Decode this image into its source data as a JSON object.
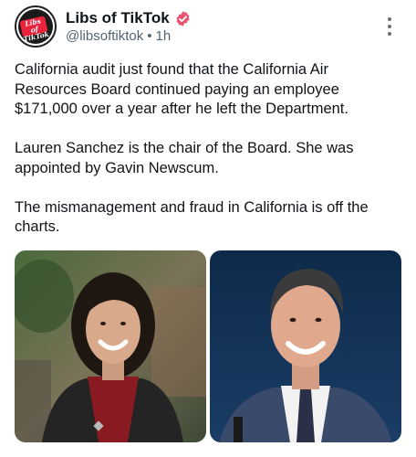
{
  "post": {
    "author": {
      "name": "Libs of TikTok",
      "handle": "@libsoftiktok",
      "separator": "•",
      "time": "1h",
      "avatar_text_line1": "Libs of",
      "avatar_text_line2": "TikTok",
      "verified": true
    },
    "menu_icon": "more-vertical-icon",
    "paragraphs": [
      "California audit just found that the California Air Resources Board continued paying an employee $171,000 over a year after he left the Department.",
      "Lauren Sanchez is the chair of the Board. She was appointed by Gavin Newscum.",
      "The mismanagement and fraud in California is off the charts."
    ],
    "media": [
      {
        "name": "photo-woman-portrait"
      },
      {
        "name": "photo-man-portrait"
      }
    ]
  },
  "colors": {
    "text": "#0f1419",
    "muted": "#536471",
    "verified_badge": "#e8556e",
    "avatar_accent": "#e9233b"
  }
}
